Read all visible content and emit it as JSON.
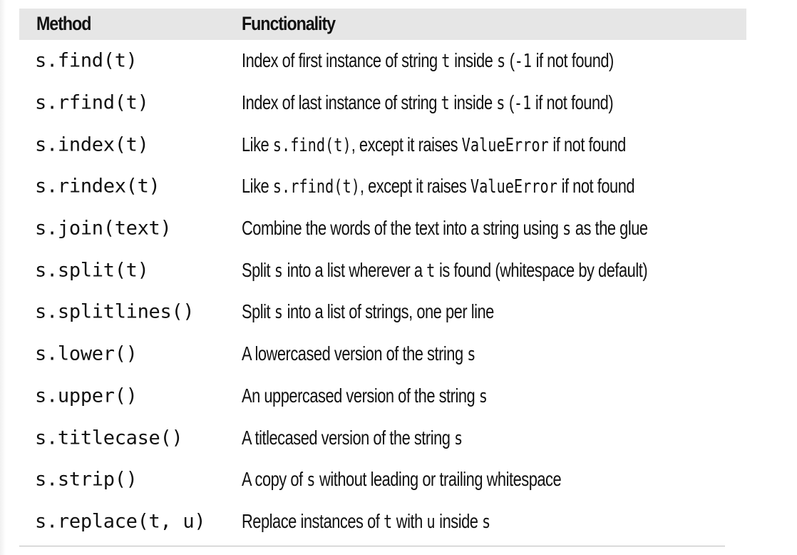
{
  "table": {
    "headers": {
      "method": "Method",
      "functionality": "Functionality"
    },
    "rows": [
      {
        "method": "s.find(t)",
        "functionality": [
          {
            "text": "Index of first instance of string "
          },
          {
            "text": "t",
            "code": true
          },
          {
            "text": " inside "
          },
          {
            "text": "s",
            "code": true
          },
          {
            "text": " ("
          },
          {
            "text": "-1",
            "code": true
          },
          {
            "text": " if not found)"
          }
        ]
      },
      {
        "method": "s.rfind(t)",
        "functionality": [
          {
            "text": "Index of last instance of string "
          },
          {
            "text": "t",
            "code": true
          },
          {
            "text": " inside "
          },
          {
            "text": "s",
            "code": true
          },
          {
            "text": " ("
          },
          {
            "text": "-1",
            "code": true
          },
          {
            "text": " if not found)"
          }
        ]
      },
      {
        "method": "s.index(t)",
        "functionality": [
          {
            "text": "Like "
          },
          {
            "text": "s.find(t)",
            "code": true
          },
          {
            "text": ", except it raises "
          },
          {
            "text": "ValueError",
            "code": true
          },
          {
            "text": " if not found"
          }
        ]
      },
      {
        "method": "s.rindex(t)",
        "functionality": [
          {
            "text": "Like "
          },
          {
            "text": "s.rfind(t)",
            "code": true
          },
          {
            "text": ", except it raises "
          },
          {
            "text": "ValueError",
            "code": true
          },
          {
            "text": " if not found"
          }
        ]
      },
      {
        "method": "s.join(text)",
        "functionality": [
          {
            "text": "Combine the words of the text into a string using "
          },
          {
            "text": "s",
            "code": true
          },
          {
            "text": " as the glue"
          }
        ]
      },
      {
        "method": "s.split(t)",
        "functionality": [
          {
            "text": "Split "
          },
          {
            "text": "s",
            "code": true
          },
          {
            "text": " into a list wherever a "
          },
          {
            "text": "t",
            "code": true
          },
          {
            "text": " is found (whitespace by default)"
          }
        ]
      },
      {
        "method": "s.splitlines()",
        "functionality": [
          {
            "text": "Split "
          },
          {
            "text": "s",
            "code": true
          },
          {
            "text": " into a list of strings, one per line"
          }
        ]
      },
      {
        "method": "s.lower()",
        "functionality": [
          {
            "text": "A lowercased version of the string "
          },
          {
            "text": "s",
            "code": true
          }
        ]
      },
      {
        "method": "s.upper()",
        "functionality": [
          {
            "text": "An uppercased version of the string "
          },
          {
            "text": "s",
            "code": true
          }
        ]
      },
      {
        "method": "s.titlecase()",
        "functionality": [
          {
            "text": "A titlecased version of the string "
          },
          {
            "text": "s",
            "code": true
          }
        ]
      },
      {
        "method": "s.strip()",
        "functionality": [
          {
            "text": "A copy of "
          },
          {
            "text": "s",
            "code": true
          },
          {
            "text": " without leading or trailing whitespace"
          }
        ]
      },
      {
        "method": "s.replace(t, u)",
        "functionality": [
          {
            "text": "Replace instances of "
          },
          {
            "text": "t",
            "code": true
          },
          {
            "text": " with "
          },
          {
            "text": "u",
            "code": true
          },
          {
            "text": " inside "
          },
          {
            "text": "s",
            "code": true
          }
        ]
      }
    ]
  }
}
